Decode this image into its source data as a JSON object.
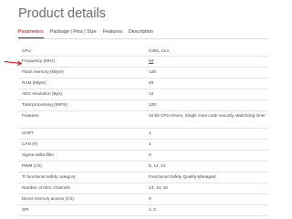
{
  "page": {
    "title": "Product details"
  },
  "tabs": [
    {
      "label": "Parameters",
      "active": true
    },
    {
      "label": "Package | Pins | Size",
      "active": false
    },
    {
      "label": "Features",
      "active": false
    },
    {
      "label": "Description",
      "active": false
    }
  ],
  "specs": [
    {
      "label": "CPU",
      "value": "C28x, CLA"
    },
    {
      "label": "Frequency (MHz)",
      "value": "60",
      "highlighted": true
    },
    {
      "label": "Flash memory (kByte)",
      "value": "128"
    },
    {
      "label": "RAM (kByte)",
      "value": "20"
    },
    {
      "label": "ADC resolution (Bps)",
      "value": "12"
    },
    {
      "label": "Total processing (MIPS)",
      "value": "120"
    },
    {
      "label": "Features",
      "value": "32-bit CPU timers, Single zone code security, Watchdog timer"
    },
    {
      "label": "UART",
      "value": "1"
    },
    {
      "label": "CAN (#)",
      "value": "1"
    },
    {
      "label": "Sigma-delta filter",
      "value": "0"
    },
    {
      "label": "PWM (Ch)",
      "value": "8, 12, 14"
    },
    {
      "label": "TI functional safety category",
      "value": "Functional Safety Quality-Managed"
    },
    {
      "label": "Number of ADC channels",
      "value": "13, 14, 16"
    },
    {
      "label": "Direct memory access (Ch)",
      "value": "0"
    },
    {
      "label": "SPI",
      "value": "1, 2"
    }
  ],
  "colors": {
    "accent": "#cc0000",
    "annotation_arrow": "#d40000"
  },
  "icons": {
    "annotation": "red-arrow-icon"
  }
}
